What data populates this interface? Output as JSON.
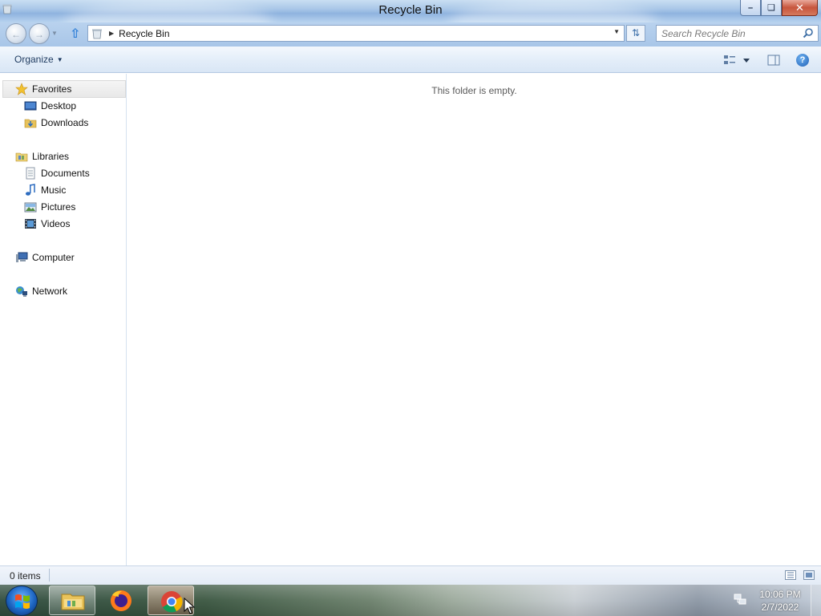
{
  "window": {
    "title": "Recycle Bin",
    "controls": {
      "minimize": "—",
      "maximize": "▢",
      "close": "✕"
    }
  },
  "address": {
    "breadcrumb": "Recycle Bin",
    "search_placeholder": "Search Recycle Bin"
  },
  "commandbar": {
    "organize_label": "Organize"
  },
  "navigation": {
    "favorites": {
      "label": "Favorites",
      "items": [
        {
          "label": "Desktop",
          "icon": "desktop-icon"
        },
        {
          "label": "Downloads",
          "icon": "downloads-folder-icon"
        }
      ]
    },
    "libraries": {
      "label": "Libraries",
      "items": [
        {
          "label": "Documents",
          "icon": "documents-icon"
        },
        {
          "label": "Music",
          "icon": "music-icon"
        },
        {
          "label": "Pictures",
          "icon": "pictures-icon"
        },
        {
          "label": "Videos",
          "icon": "videos-icon"
        }
      ]
    },
    "computer": {
      "label": "Computer",
      "icon": "computer-icon"
    },
    "network": {
      "label": "Network",
      "icon": "network-icon"
    }
  },
  "content": {
    "empty_message": "This folder is empty."
  },
  "statusbar": {
    "item_count": "0 items"
  },
  "taskbar": {
    "pinned": [
      "windows-explorer-icon",
      "firefox-icon",
      "chrome-icon"
    ],
    "active": "chrome-icon",
    "clock": {
      "time": "10:06 PM",
      "date": "2/7/2022"
    }
  },
  "colors": {
    "titlebar": "#a9c7e8",
    "close_button": "#c7553d",
    "nav_link": "#1e3a5f",
    "start_orb": "#1d65c2"
  }
}
